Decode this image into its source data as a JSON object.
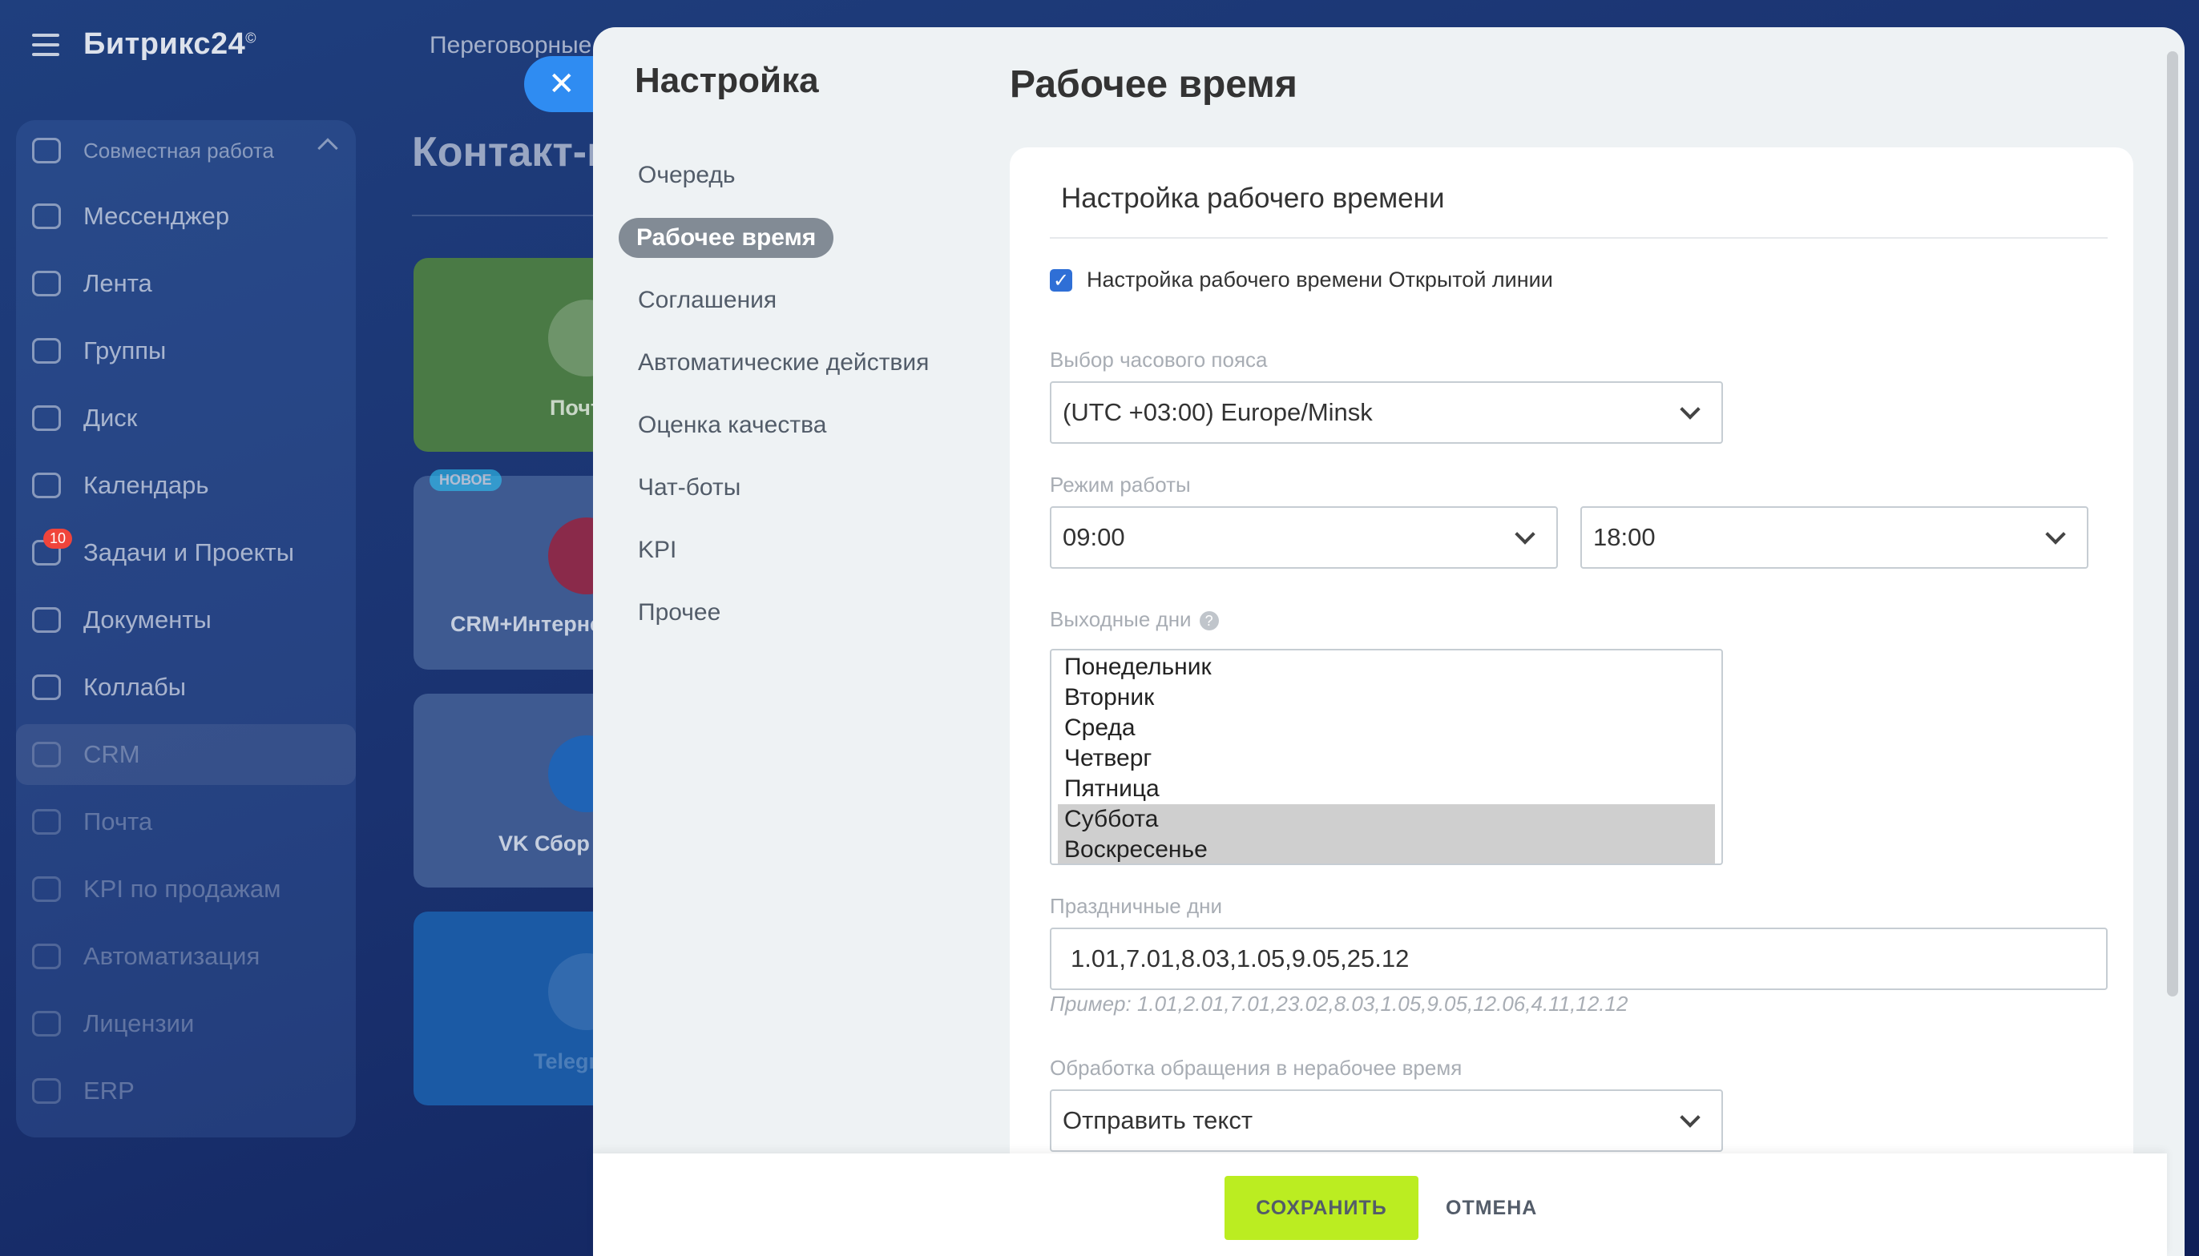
{
  "portal": {
    "logo": "Битрикс24",
    "logo_mark": "©",
    "top_link": "Переговорные",
    "page_title": "Контакт-ц",
    "sidebar": {
      "items": [
        {
          "label": "Совместная работа",
          "icon": "collab-icon"
        },
        {
          "label": "Мессенджер",
          "icon": "messenger-icon"
        },
        {
          "label": "Лента",
          "icon": "feed-icon"
        },
        {
          "label": "Группы",
          "icon": "groups-icon"
        },
        {
          "label": "Диск",
          "icon": "disk-icon"
        },
        {
          "label": "Календарь",
          "icon": "calendar-icon"
        },
        {
          "label": "Задачи и Проекты",
          "icon": "tasks-icon",
          "badge": "10"
        },
        {
          "label": "Документы",
          "icon": "documents-icon"
        },
        {
          "label": "Коллабы",
          "icon": "collabs-icon"
        },
        {
          "label": "CRM",
          "icon": "crm-icon"
        },
        {
          "label": "Почта",
          "icon": "mail-icon"
        },
        {
          "label": "KPI по продажам",
          "icon": "kpi-icon"
        },
        {
          "label": "Автоматизация",
          "icon": "automation-icon"
        },
        {
          "label": "Лицензии",
          "icon": "license-icon"
        },
        {
          "label": "ERP",
          "icon": "erp-icon"
        }
      ]
    },
    "cards": [
      {
        "label": "Почт",
        "color": "#3f8a4a"
      },
      {
        "label": "CRM+Интерне",
        "color": "#3a5a9a",
        "badge": "НОВОЕ"
      },
      {
        "label": "VK Сбор",
        "color": "#3a5a9a"
      },
      {
        "label": "Telegr",
        "color": "#1b67b6"
      }
    ]
  },
  "close_button": {
    "icon": "close-icon",
    "glyph": "✕"
  },
  "settings": {
    "nav_title": "Настройка",
    "nav_items": [
      {
        "label": "Очередь",
        "active": false
      },
      {
        "label": "Рабочее время",
        "active": true
      },
      {
        "label": "Соглашения",
        "active": false
      },
      {
        "label": "Автоматические действия",
        "active": false
      },
      {
        "label": "Оценка качества",
        "active": false
      },
      {
        "label": "Чат-боты",
        "active": false
      },
      {
        "label": "KPI",
        "active": false
      },
      {
        "label": "Прочее",
        "active": false
      }
    ],
    "page_title": "Рабочее время",
    "section_title": "Настройка рабочего времени",
    "enable_checkbox": {
      "label": "Настройка рабочего времени Открытой линии",
      "checked": true
    },
    "timezone": {
      "label": "Выбор часового пояса",
      "value": "(UTC +03:00) Europe/Minsk"
    },
    "work_mode": {
      "label": "Режим работы",
      "from": "09:00",
      "to": "18:00"
    },
    "days_off": {
      "label": "Выходные дни",
      "options": [
        {
          "label": "Понедельник",
          "selected": false
        },
        {
          "label": "Вторник",
          "selected": false
        },
        {
          "label": "Среда",
          "selected": false
        },
        {
          "label": "Четверг",
          "selected": false
        },
        {
          "label": "Пятница",
          "selected": false
        },
        {
          "label": "Суббота",
          "selected": true
        },
        {
          "label": "Воскресенье",
          "selected": true
        }
      ]
    },
    "holidays": {
      "label": "Праздничные дни",
      "value": "1.01,7.01,8.03,1.05,9.05,25.12",
      "hint": "Пример: 1.01,2.01,7.01,23.02,8.03,1.05,9.05,12.06,4.11,12.12"
    },
    "off_hours": {
      "label": "Обработка обращения в нерабочее время",
      "value": "Отправить текст"
    }
  },
  "footer": {
    "save_label": "СОХРАНИТЬ",
    "cancel_label": "ОТМЕНА"
  },
  "colors": {
    "save_button": "#bbed21",
    "checkbox": "#2f6fd6",
    "close_button": "#2f8cf2",
    "active_nav": "#828b95"
  }
}
